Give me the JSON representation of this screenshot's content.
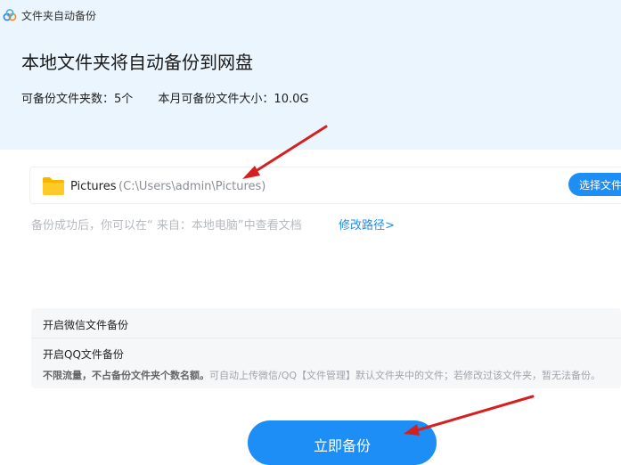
{
  "window": {
    "title": "文件夹自动备份"
  },
  "header": {
    "title": "本地文件夹将自动备份到网盘",
    "stats": {
      "folders": "可备份文件夹数：5个",
      "size": "本月可备份文件大小：10.0G"
    }
  },
  "folder": {
    "name": "Pictures",
    "path": "(C:\\Users\\admin\\Pictures)",
    "choose_label": "选择文件夹"
  },
  "hint": {
    "text": "备份成功后，你可以在“ 来自：本地电脑”中查看文档",
    "modify_link": "修改路径>"
  },
  "options": {
    "wechat": "开启微信文件备份",
    "qq": "开启QQ文件备份",
    "desc_bold": "不限流量，不占备份文件夹个数名额。",
    "desc_normal": "可自动上传微信/QQ【文件管理】默认文件夹中的文件；若修改过该文件夹，暂无法备份。"
  },
  "action": {
    "backup_label": "立即备份"
  },
  "colors": {
    "accent": "#1c8ef5",
    "header_bg": "#eaf5fd",
    "annotation_arrow": "#d42020"
  },
  "icons": {
    "app": "cloud-logo-icon",
    "folder": "folder-icon",
    "annotation": "red-arrow-icon"
  }
}
